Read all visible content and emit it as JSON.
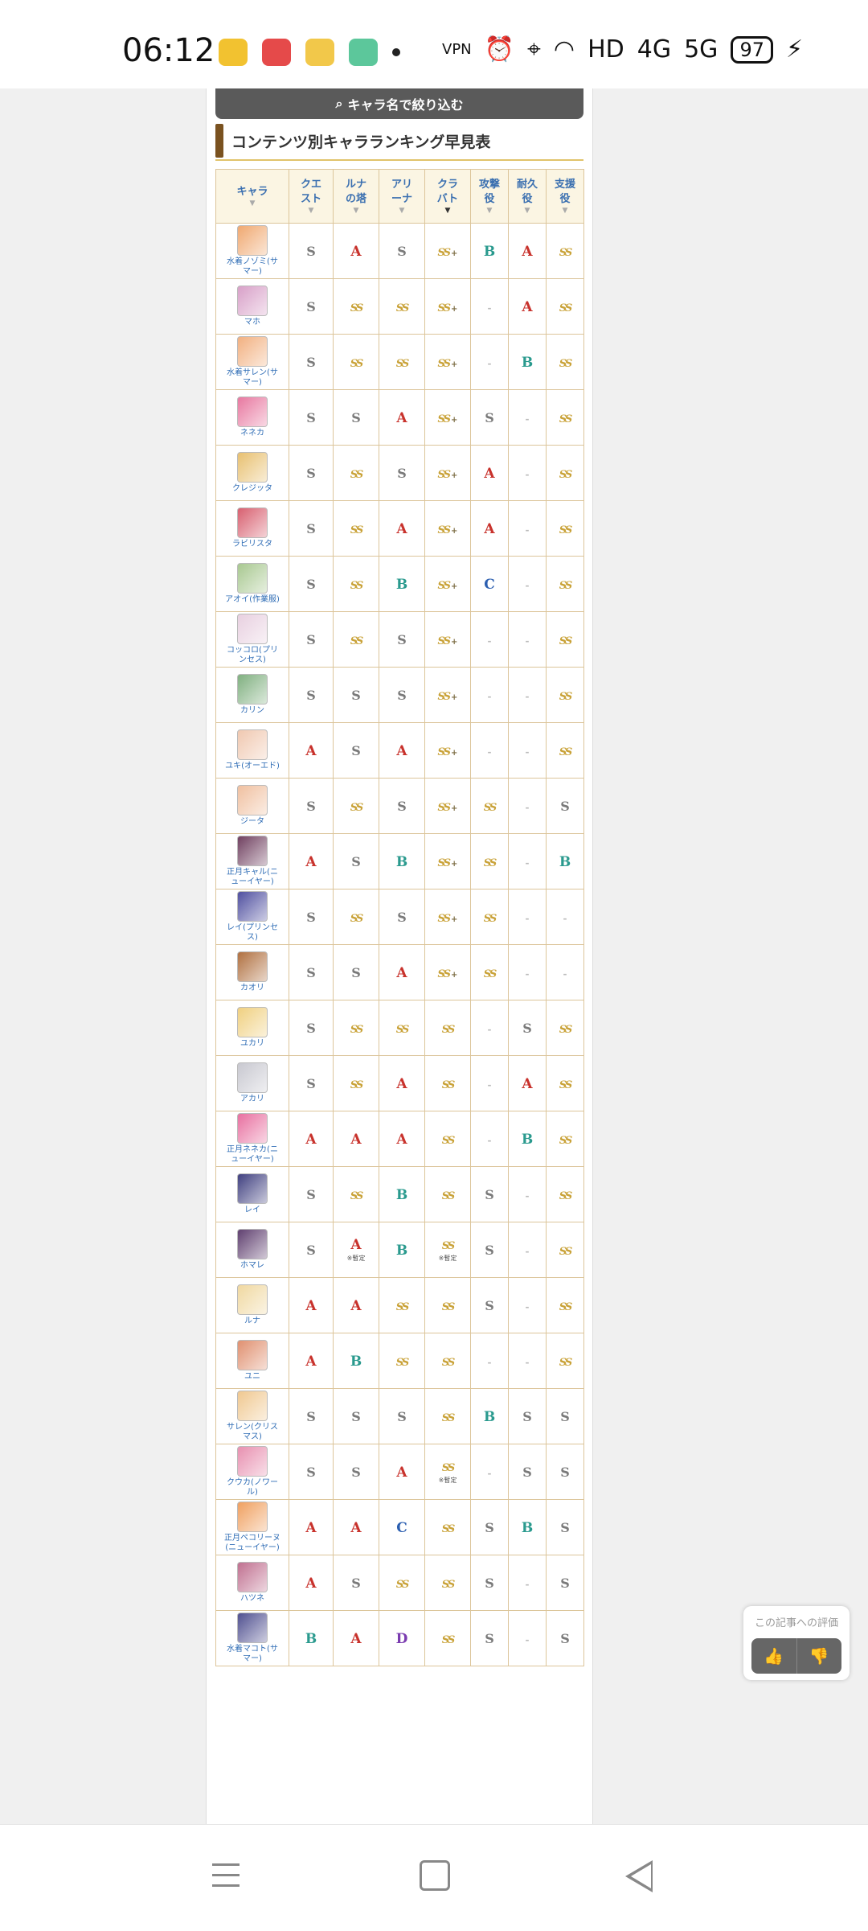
{
  "status_bar": {
    "time": "06:12",
    "network": "HD",
    "signal_a": "4G",
    "signal_b": "5G",
    "battery": "97"
  },
  "filter_button": {
    "label": "キャラ名で絞り込む"
  },
  "section": {
    "title": "コンテンツ別キャラランキング早見表"
  },
  "table": {
    "headers": [
      "キャラ",
      "クエスト",
      "ルナの塔",
      "アリーナ",
      "クラバト",
      "攻撃役",
      "耐久役",
      "支援役"
    ],
    "sort_active_column": 4,
    "rows": [
      {
        "name": "水着ノゾミ(サマー)",
        "color": "#f0a870",
        "grades": [
          "S",
          "A",
          "S",
          "SSP",
          "B",
          "A",
          "SS"
        ]
      },
      {
        "name": "マホ",
        "color": "#d8a0c8",
        "grades": [
          "S",
          "SS",
          "SS",
          "SSP",
          "-",
          "A",
          "SS"
        ]
      },
      {
        "name": "水着サレン(サマー)",
        "color": "#f2b080",
        "grades": [
          "S",
          "SS",
          "SS",
          "SSP",
          "-",
          "B",
          "SS"
        ]
      },
      {
        "name": "ネネカ",
        "color": "#e878a0",
        "grades": [
          "S",
          "S",
          "A",
          "SSP",
          "S",
          "-",
          "SS"
        ]
      },
      {
        "name": "クレジッタ",
        "color": "#e8c070",
        "grades": [
          "S",
          "SS",
          "S",
          "SSP",
          "A",
          "-",
          "SS"
        ]
      },
      {
        "name": "ラビリスタ",
        "color": "#d86070",
        "grades": [
          "S",
          "SS",
          "A",
          "SSP",
          "A",
          "-",
          "SS"
        ]
      },
      {
        "name": "アオイ(作業服)",
        "color": "#a8c890",
        "grades": [
          "S",
          "SS",
          "B",
          "SSP",
          "C",
          "-",
          "SS"
        ]
      },
      {
        "name": "コッコロ(プリンセス)",
        "color": "#e8d0e0",
        "grades": [
          "S",
          "SS",
          "S",
          "SSP",
          "-",
          "-",
          "SS"
        ]
      },
      {
        "name": "カリン",
        "color": "#80b080",
        "grades": [
          "S",
          "S",
          "S",
          "SSP",
          "-",
          "-",
          "SS"
        ]
      },
      {
        "name": "ユキ(オーエド)",
        "color": "#f0c8b0",
        "grades": [
          "A",
          "S",
          "A",
          "SSP",
          "-",
          "-",
          "SS"
        ]
      },
      {
        "name": "ジータ",
        "color": "#f0c0a0",
        "grades": [
          "S",
          "SS",
          "S",
          "SSP",
          "SS",
          "-",
          "S"
        ]
      },
      {
        "name": "正月キャル(ニューイヤー)",
        "color": "#704060",
        "grades": [
          "A",
          "S",
          "B",
          "SSP",
          "SS",
          "-",
          "B"
        ]
      },
      {
        "name": "レイ(プリンセス)",
        "color": "#5050a0",
        "grades": [
          "S",
          "SS",
          "S",
          "SSP",
          "SS",
          "-",
          "-"
        ]
      },
      {
        "name": "カオリ",
        "color": "#b07040",
        "grades": [
          "S",
          "S",
          "A",
          "SSP",
          "SS",
          "-",
          "-"
        ]
      },
      {
        "name": "ユカリ",
        "color": "#f0d080",
        "grades": [
          "S",
          "SS",
          "SS",
          "SS",
          "-",
          "S",
          "SS"
        ]
      },
      {
        "name": "アカリ",
        "color": "#c8c8d0",
        "grades": [
          "S",
          "SS",
          "A",
          "SS",
          "-",
          "A",
          "SS"
        ]
      },
      {
        "name": "正月ネネカ(ニューイヤー)",
        "color": "#e870a0",
        "grades": [
          "A",
          "A",
          "A",
          "SS",
          "-",
          "B",
          "SS"
        ]
      },
      {
        "name": "レイ",
        "color": "#404080",
        "grades": [
          "S",
          "SS",
          "B",
          "SS",
          "S",
          "-",
          "SS"
        ]
      },
      {
        "name": "ホマレ",
        "color": "#604070",
        "grades": [
          "S",
          "A",
          "B",
          "SS",
          "S",
          "-",
          "SS"
        ],
        "notes": {
          "1": "※暫定",
          "3": "※暫定"
        }
      },
      {
        "name": "ルナ",
        "color": "#f0d8a0",
        "grades": [
          "A",
          "A",
          "SS",
          "SS",
          "S",
          "-",
          "SS"
        ]
      },
      {
        "name": "ユニ",
        "color": "#e09070",
        "grades": [
          "A",
          "B",
          "SS",
          "SS",
          "-",
          "-",
          "SS"
        ]
      },
      {
        "name": "サレン(クリスマス)",
        "color": "#f0c890",
        "grades": [
          "S",
          "S",
          "S",
          "SS",
          "B",
          "S",
          "S"
        ]
      },
      {
        "name": "クウカ(ノワール)",
        "color": "#e890b0",
        "grades": [
          "S",
          "S",
          "A",
          "SS",
          "-",
          "S",
          "S"
        ],
        "notes": {
          "3": "※暫定"
        }
      },
      {
        "name": "正月ペコリーヌ(ニューイヤー)",
        "color": "#f0a060",
        "grades": [
          "A",
          "A",
          "C",
          "SS",
          "S",
          "B",
          "S"
        ]
      },
      {
        "name": "ハツネ",
        "color": "#c07090",
        "grades": [
          "A",
          "S",
          "SS",
          "SS",
          "S",
          "-",
          "S"
        ]
      },
      {
        "name": "水着マコト(サマー)",
        "color": "#505090",
        "grades": [
          "B",
          "A",
          "D",
          "SS",
          "S",
          "-",
          "S"
        ]
      }
    ]
  },
  "rating_widget": {
    "label": "この記事への評価",
    "like_icon": "thumbs-up-icon",
    "dislike_icon": "thumbs-down-icon"
  },
  "colors": {
    "header_text": "#3a6fb0",
    "border": "#dcc59a",
    "grade_A": "#c8322c",
    "grade_B": "#2a9a8e",
    "grade_SS": "#c9a238"
  }
}
